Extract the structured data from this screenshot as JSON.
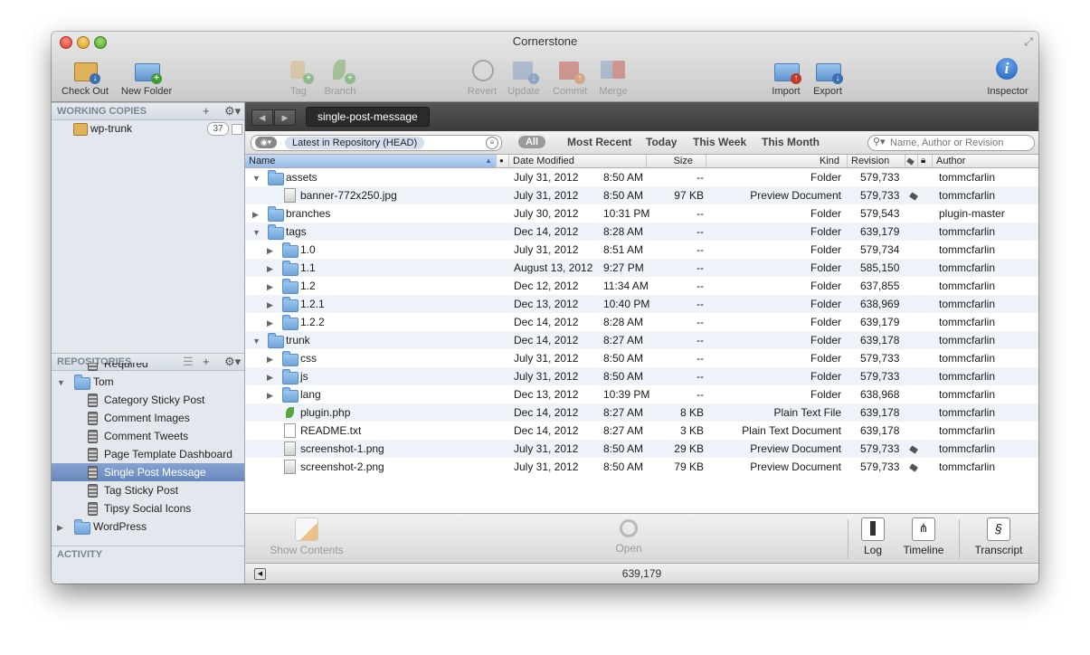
{
  "window": {
    "title": "Cornerstone"
  },
  "toolbar": {
    "checkout": "Check Out",
    "new_folder": "New Folder",
    "tag": "Tag",
    "branch": "Branch",
    "revert": "Revert",
    "update": "Update",
    "commit": "Commit",
    "merge": "Merge",
    "import": "Import",
    "export": "Export",
    "inspector": "Inspector"
  },
  "sidebar": {
    "working_copies_title": "WORKING COPIES",
    "working_copy": {
      "name": "wp-trunk",
      "count": "37"
    },
    "repositories_title": "REPOSITORIES",
    "repos": [
      {
        "label": "Required",
        "type": "repo",
        "depth": 2
      },
      {
        "label": "Tom",
        "type": "folder",
        "depth": 1,
        "expanded": true
      },
      {
        "label": "Category Sticky Post",
        "type": "repo",
        "depth": 2
      },
      {
        "label": "Comment Images",
        "type": "repo",
        "depth": 2
      },
      {
        "label": "Comment Tweets",
        "type": "repo",
        "depth": 2
      },
      {
        "label": "Page Template Dashboard",
        "type": "repo",
        "depth": 2
      },
      {
        "label": "Single Post Message",
        "type": "repo",
        "depth": 2,
        "selected": true
      },
      {
        "label": "Tag Sticky Post",
        "type": "repo",
        "depth": 2
      },
      {
        "label": "Tipsy Social Icons",
        "type": "repo",
        "depth": 2
      },
      {
        "label": "WordPress",
        "type": "folder",
        "depth": 1,
        "expanded": false
      }
    ],
    "activity_title": "ACTIVITY"
  },
  "path": {
    "current": "single-post-message"
  },
  "filter": {
    "revision": "Latest in Repository (HEAD)",
    "all": "All",
    "most_recent": "Most Recent",
    "today": "Today",
    "this_week": "This Week",
    "this_month": "This Month",
    "search_placeholder": "Name, Author or Revision"
  },
  "columns": {
    "name": "Name",
    "date": "Date Modified",
    "size": "Size",
    "kind": "Kind",
    "revision": "Revision",
    "author": "Author"
  },
  "files": [
    {
      "name": "assets",
      "depth": 0,
      "type": "folder",
      "expanded": true,
      "date": "July 31, 2012",
      "time": "8:50 AM",
      "size": "--",
      "kind": "Folder",
      "revision": "579,733",
      "tagged": false,
      "author": "tommcfarlin"
    },
    {
      "name": "banner-772x250.jpg",
      "depth": 1,
      "type": "image",
      "date": "July 31, 2012",
      "time": "8:50 AM",
      "size": "97 KB",
      "kind": "Preview Document",
      "revision": "579,733",
      "tagged": true,
      "author": "tommcfarlin"
    },
    {
      "name": "branches",
      "depth": 0,
      "type": "folder",
      "expanded": false,
      "date": "July 30, 2012",
      "time": "10:31 PM",
      "size": "--",
      "kind": "Folder",
      "revision": "579,543",
      "tagged": false,
      "author": "plugin-master"
    },
    {
      "name": "tags",
      "depth": 0,
      "type": "folder",
      "expanded": true,
      "date": "Dec 14, 2012",
      "time": "8:28 AM",
      "size": "--",
      "kind": "Folder",
      "revision": "639,179",
      "tagged": false,
      "author": "tommcfarlin"
    },
    {
      "name": "1.0",
      "depth": 1,
      "type": "folder",
      "expanded": false,
      "date": "July 31, 2012",
      "time": "8:51 AM",
      "size": "--",
      "kind": "Folder",
      "revision": "579,734",
      "tagged": false,
      "author": "tommcfarlin"
    },
    {
      "name": "1.1",
      "depth": 1,
      "type": "folder",
      "expanded": false,
      "date": "August 13, 2012",
      "time": "9:27 PM",
      "size": "--",
      "kind": "Folder",
      "revision": "585,150",
      "tagged": false,
      "author": "tommcfarlin"
    },
    {
      "name": "1.2",
      "depth": 1,
      "type": "folder",
      "expanded": false,
      "date": "Dec 12, 2012",
      "time": "11:34 AM",
      "size": "--",
      "kind": "Folder",
      "revision": "637,855",
      "tagged": false,
      "author": "tommcfarlin"
    },
    {
      "name": "1.2.1",
      "depth": 1,
      "type": "folder",
      "expanded": false,
      "date": "Dec 13, 2012",
      "time": "10:40 PM",
      "size": "--",
      "kind": "Folder",
      "revision": "638,969",
      "tagged": false,
      "author": "tommcfarlin"
    },
    {
      "name": "1.2.2",
      "depth": 1,
      "type": "folder",
      "expanded": false,
      "date": "Dec 14, 2012",
      "time": "8:28 AM",
      "size": "--",
      "kind": "Folder",
      "revision": "639,179",
      "tagged": false,
      "author": "tommcfarlin"
    },
    {
      "name": "trunk",
      "depth": 0,
      "type": "folder",
      "expanded": true,
      "date": "Dec 14, 2012",
      "time": "8:27 AM",
      "size": "--",
      "kind": "Folder",
      "revision": "639,178",
      "tagged": false,
      "author": "tommcfarlin"
    },
    {
      "name": "css",
      "depth": 1,
      "type": "folder",
      "expanded": false,
      "date": "July 31, 2012",
      "time": "8:50 AM",
      "size": "--",
      "kind": "Folder",
      "revision": "579,733",
      "tagged": false,
      "author": "tommcfarlin"
    },
    {
      "name": "js",
      "depth": 1,
      "type": "folder",
      "expanded": false,
      "date": "July 31, 2012",
      "time": "8:50 AM",
      "size": "--",
      "kind": "Folder",
      "revision": "579,733",
      "tagged": false,
      "author": "tommcfarlin"
    },
    {
      "name": "lang",
      "depth": 1,
      "type": "folder",
      "expanded": false,
      "date": "Dec 13, 2012",
      "time": "10:39 PM",
      "size": "--",
      "kind": "Folder",
      "revision": "638,968",
      "tagged": false,
      "author": "tommcfarlin"
    },
    {
      "name": "plugin.php",
      "depth": 1,
      "type": "php",
      "date": "Dec 14, 2012",
      "time": "8:27 AM",
      "size": "8 KB",
      "kind": "Plain Text File",
      "revision": "639,178",
      "tagged": false,
      "author": "tommcfarlin"
    },
    {
      "name": "README.txt",
      "depth": 1,
      "type": "text",
      "date": "Dec 14, 2012",
      "time": "8:27 AM",
      "size": "3 KB",
      "kind": "Plain Text Document",
      "revision": "639,178",
      "tagged": false,
      "author": "tommcfarlin"
    },
    {
      "name": "screenshot-1.png",
      "depth": 1,
      "type": "image",
      "date": "July 31, 2012",
      "time": "8:50 AM",
      "size": "29 KB",
      "kind": "Preview Document",
      "revision": "579,733",
      "tagged": true,
      "author": "tommcfarlin"
    },
    {
      "name": "screenshot-2.png",
      "depth": 1,
      "type": "image",
      "date": "July 31, 2012",
      "time": "8:50 AM",
      "size": "79 KB",
      "kind": "Preview Document",
      "revision": "579,733",
      "tagged": true,
      "author": "tommcfarlin"
    }
  ],
  "bottom": {
    "show_contents": "Show Contents",
    "open": "Open",
    "log": "Log",
    "timeline": "Timeline",
    "transcript": "Transcript"
  },
  "status": {
    "revision": "639,179"
  },
  "colors": {
    "selection": "#6a87bd",
    "sidebar_bg": "#e3e8ee",
    "row_alt": "#eef3fa",
    "pathbar": "#3b3b3b"
  },
  "icons": [
    "checkout-icon",
    "new-folder-icon",
    "tag-icon",
    "branch-icon",
    "revert-icon",
    "update-icon",
    "commit-icon",
    "merge-icon",
    "import-icon",
    "export-icon",
    "inspector-icon",
    "search-icon",
    "gear-icon",
    "add-icon",
    "folder-icon",
    "repository-icon",
    "file-icon",
    "tag-badge-icon",
    "show-contents-icon",
    "open-icon",
    "log-icon",
    "timeline-icon",
    "transcript-icon"
  ]
}
